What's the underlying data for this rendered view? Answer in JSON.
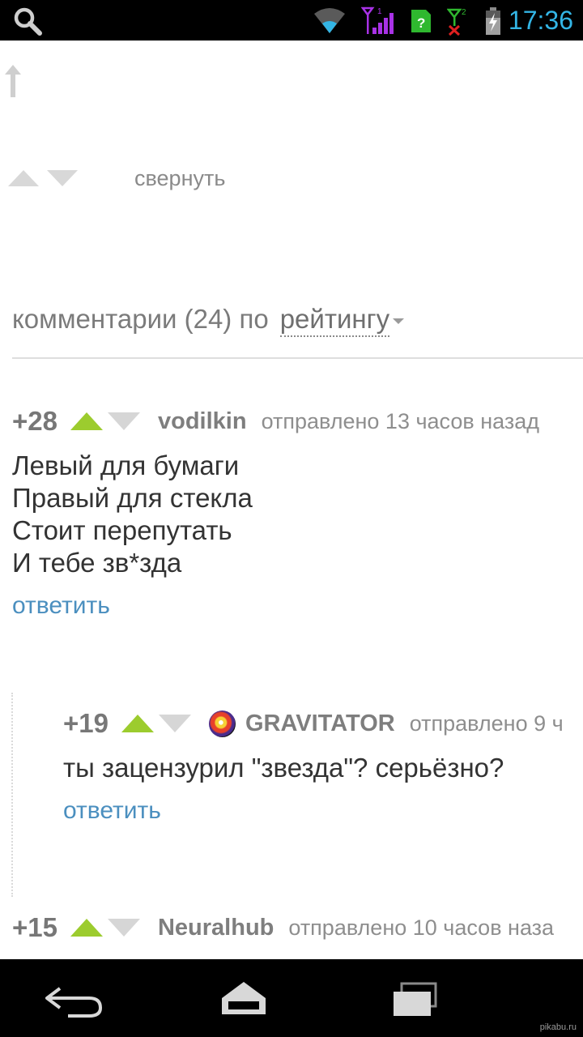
{
  "status_bar": {
    "time": "17:36",
    "icons": [
      "search-icon",
      "wifi-icon",
      "signal-sim1-icon",
      "unknown-notification-icon",
      "signal-sim2-no-service-icon",
      "battery-charging-icon"
    ],
    "accent_color": "#33b5e5"
  },
  "content": {
    "collapse_label": "свернуть",
    "comments_header": {
      "label": "комментарии (24) по",
      "sort_value": "рейтингу"
    },
    "comments": [
      {
        "rating": "+28",
        "author": "vodilkin",
        "meta": "отправлено  13 часов назад",
        "body": [
          "Левый для бумаги",
          "Правый для стекла",
          "Стоит перепутать",
          "И тебе зв*зда"
        ],
        "reply_label": "ответить"
      },
      {
        "rating": "+19",
        "author": "GRAVITATOR",
        "meta": "отправлено  9 ч",
        "body": [
          "ты зацензурил \"звезда\"? серьёзно?"
        ],
        "reply_label": "ответить"
      },
      {
        "rating": "+15",
        "author": "Neuralhub",
        "meta": "отправлено  10 часов наза"
      }
    ],
    "colors": {
      "upvote_green": "#9ccc2e",
      "downvote_grey": "#d6d6d6",
      "reply_link": "#4b8fbf"
    }
  },
  "nav_bar": {
    "buttons": [
      "back-icon",
      "home-icon",
      "recent-apps-icon"
    ]
  },
  "watermark": "pikabu.ru"
}
